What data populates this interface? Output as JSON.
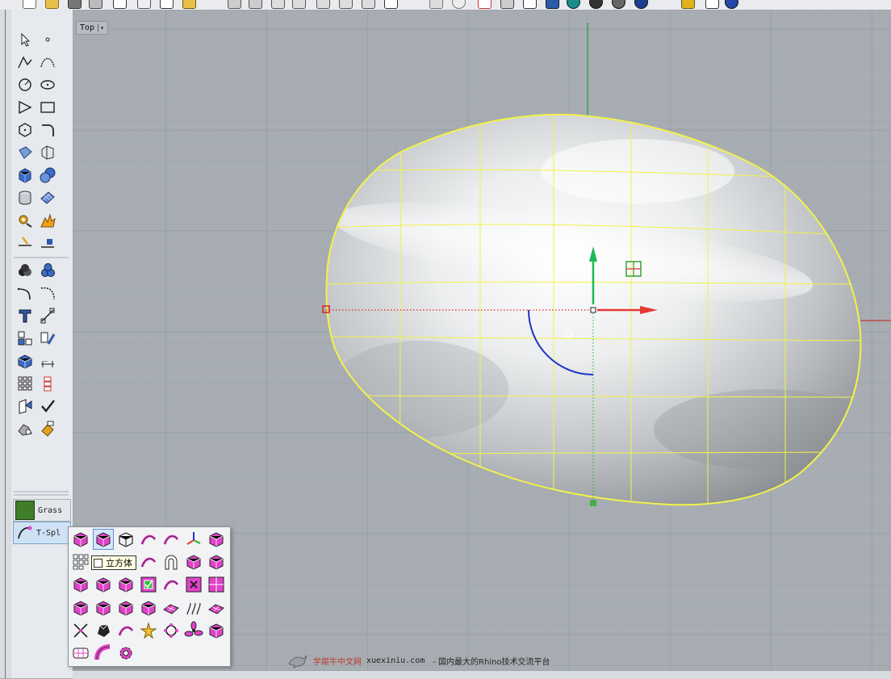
{
  "viewport": {
    "name": "Top",
    "menu_arrow": "▾"
  },
  "sidebar": {
    "tabs": [
      {
        "label": "Grass",
        "active": false
      },
      {
        "label": "T-Spl",
        "active": true
      }
    ]
  },
  "popup": {
    "tooltip": "立方体"
  },
  "watermark": {
    "brand": "学犀牛中文网",
    "site": "xuexiniu.com",
    "slogan": "- 国内最大的Rhino技术交流平台"
  },
  "colors": {
    "viewport_bg": "#a7adb2",
    "grid_minor": "#9aa1a7",
    "grid_major": "#8b9298",
    "selection": "#f2f24a",
    "x_axis": "#e53935",
    "y_axis": "#1db954",
    "gumball_arc": "#1f33c6",
    "t_spline_magenta": "#e043c9"
  }
}
